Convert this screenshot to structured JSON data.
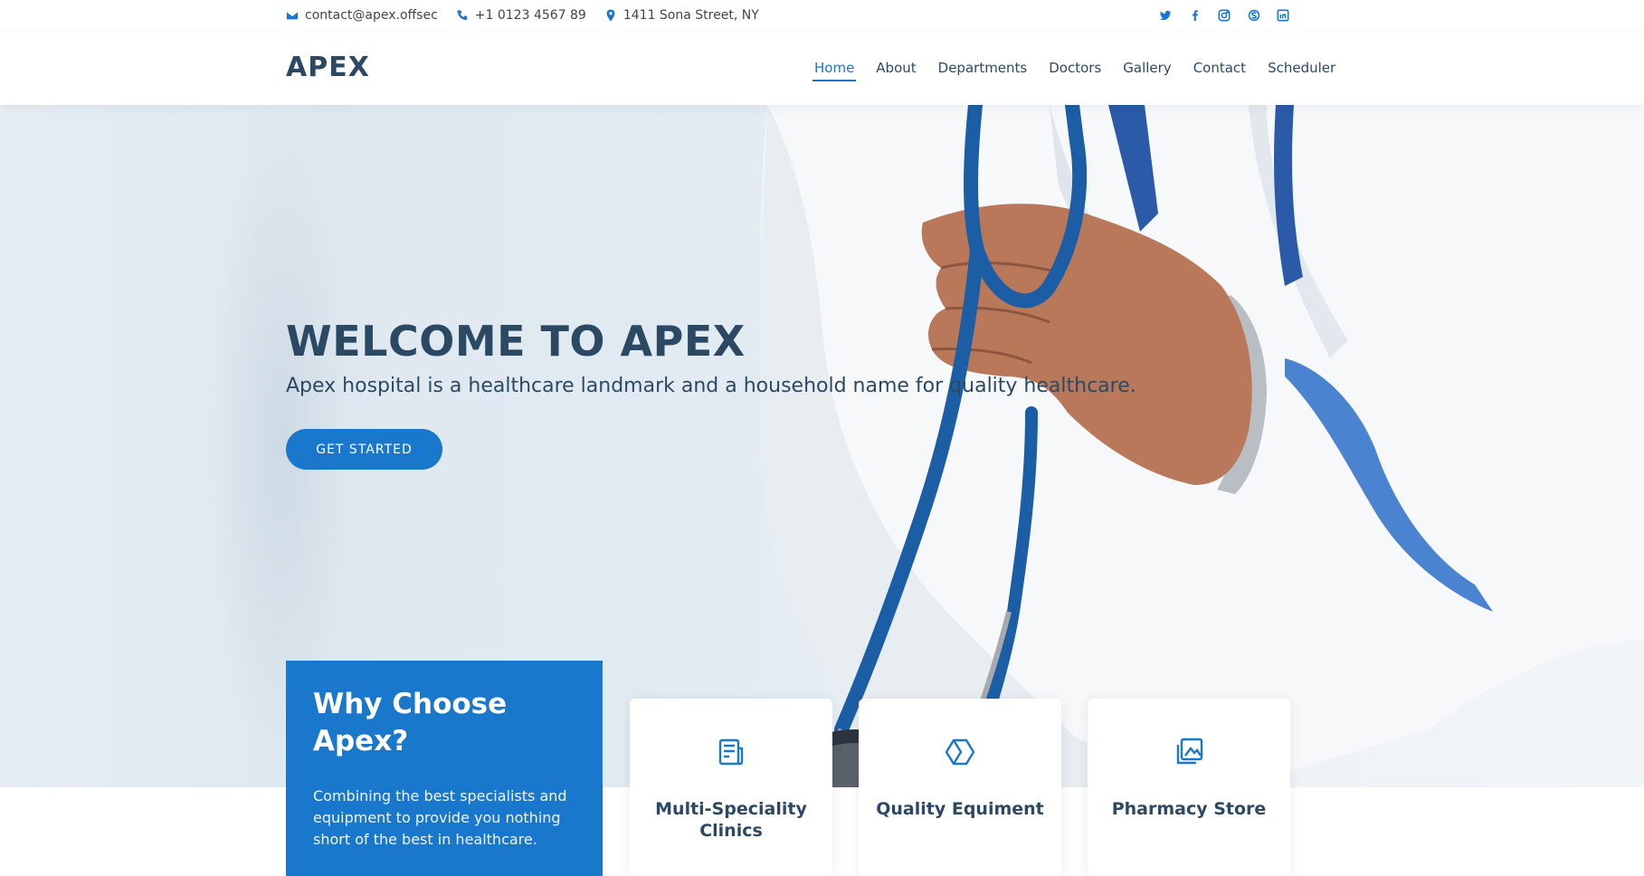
{
  "topbar": {
    "email": "contact@apex.offsec",
    "phone": "+1 0123 4567 89",
    "address": "1411 Sona Street, NY",
    "social": [
      "twitter-icon",
      "facebook-icon",
      "instagram-icon",
      "skype-icon",
      "linkedin-icon"
    ]
  },
  "header": {
    "logo": "APEX",
    "nav": [
      {
        "label": "Home",
        "active": true
      },
      {
        "label": "About"
      },
      {
        "label": "Departments"
      },
      {
        "label": "Doctors"
      },
      {
        "label": "Gallery"
      },
      {
        "label": "Contact"
      },
      {
        "label": "Scheduler"
      }
    ]
  },
  "hero": {
    "title": "WELCOME TO APEX",
    "subtitle": "Apex hospital is a healthcare landmark and a household name for quality healthcare.",
    "cta": "GET STARTED"
  },
  "why": {
    "title": "Why Choose Apex?",
    "text": "Combining the best specialists and equipment to provide you nothing short of the best in healthcare."
  },
  "features": [
    {
      "title": "Multi-Speciality Clinics",
      "icon": "clinic-icon"
    },
    {
      "title": "Quality Equiment",
      "icon": "hexagon-icon"
    },
    {
      "title": "Pharmacy Store",
      "icon": "images-icon"
    }
  ],
  "colors": {
    "accent": "#1977cc",
    "heading": "#2c4964"
  }
}
